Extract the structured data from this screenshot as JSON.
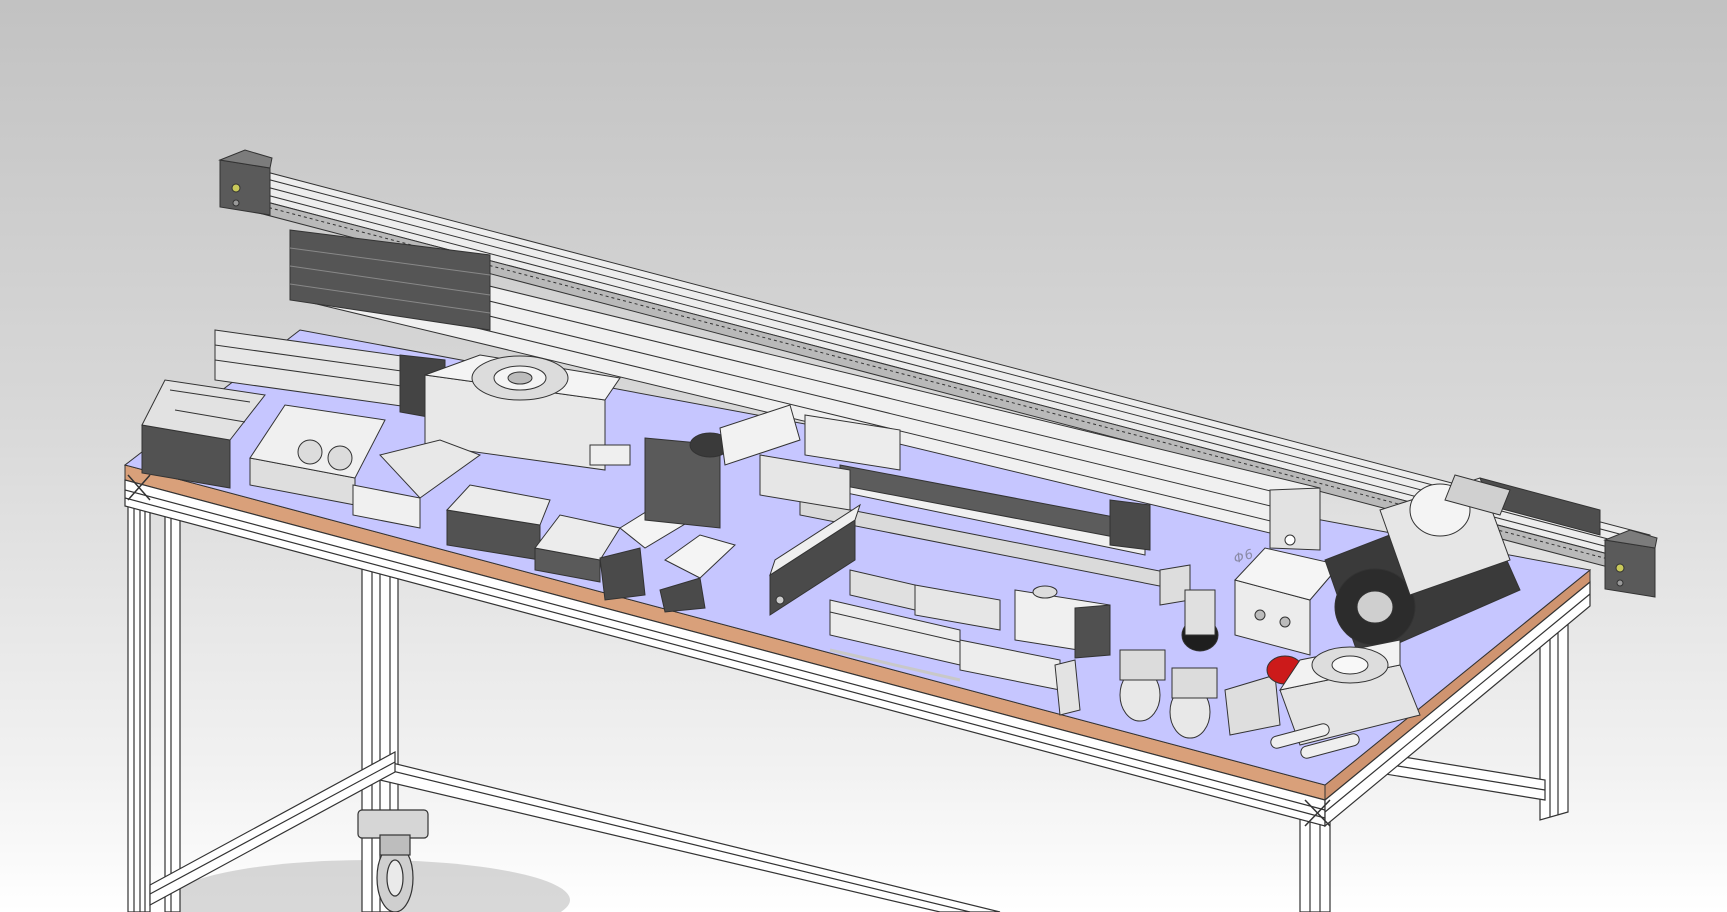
{
  "viewport": {
    "annotation_text": "Φ6"
  },
  "colors": {
    "background_top": "#c2c2c2",
    "background_bottom": "#ffffff",
    "table_top": "#c6c6ff",
    "table_edge": "#d9a07a",
    "frame": "#ffffff",
    "frame_line": "#333333",
    "aluminum": "#e8e8e8",
    "dark_part": "#5c5c5c",
    "accent_red": "#cc1a1a"
  }
}
